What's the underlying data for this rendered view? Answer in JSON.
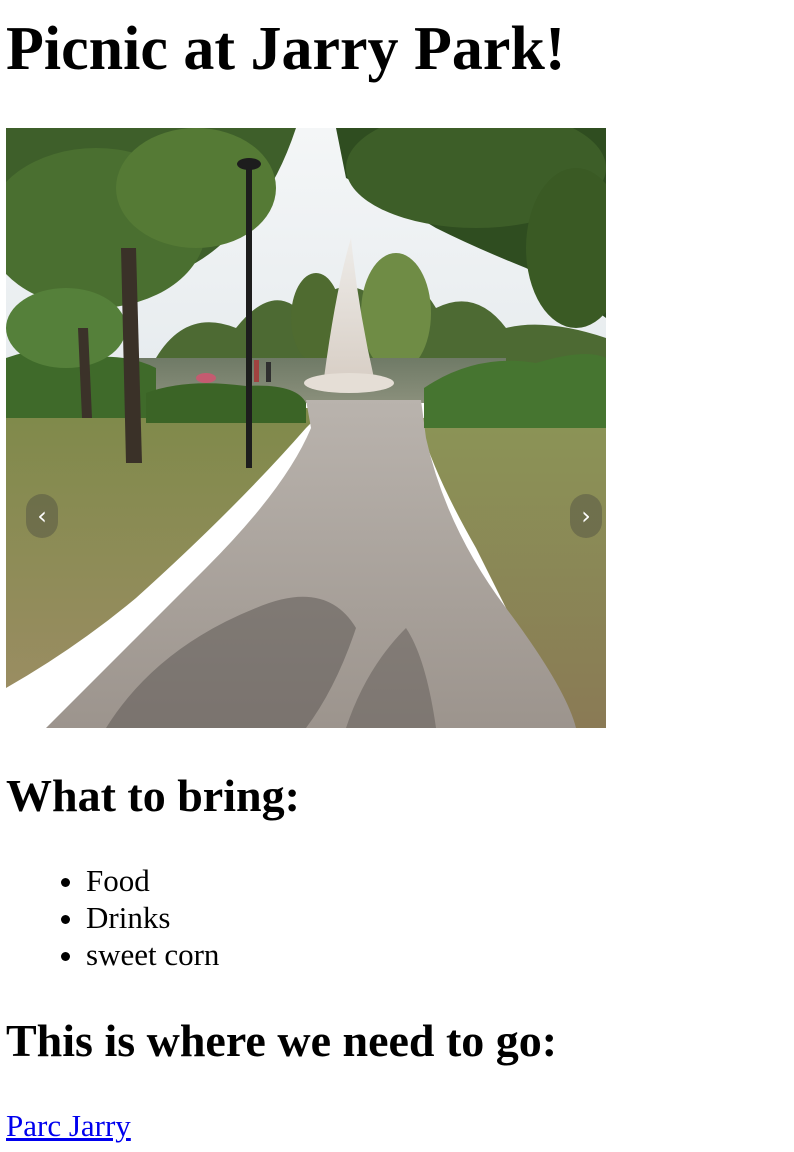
{
  "page": {
    "title": "Picnic at Jarry Park!"
  },
  "carousel": {
    "image_description": "park-path-fountain-photo",
    "prev_icon": "chevron-left-icon",
    "next_icon": "chevron-right-icon",
    "prev_glyph": "‹",
    "next_glyph": "›"
  },
  "bring": {
    "heading": "What to bring:",
    "items": [
      "Food",
      "Drinks",
      "sweet corn"
    ]
  },
  "location": {
    "heading": "This is where we need to go:",
    "link_text": "Parc Jarry"
  },
  "colors": {
    "link": "#0000ee",
    "text": "#000000"
  }
}
